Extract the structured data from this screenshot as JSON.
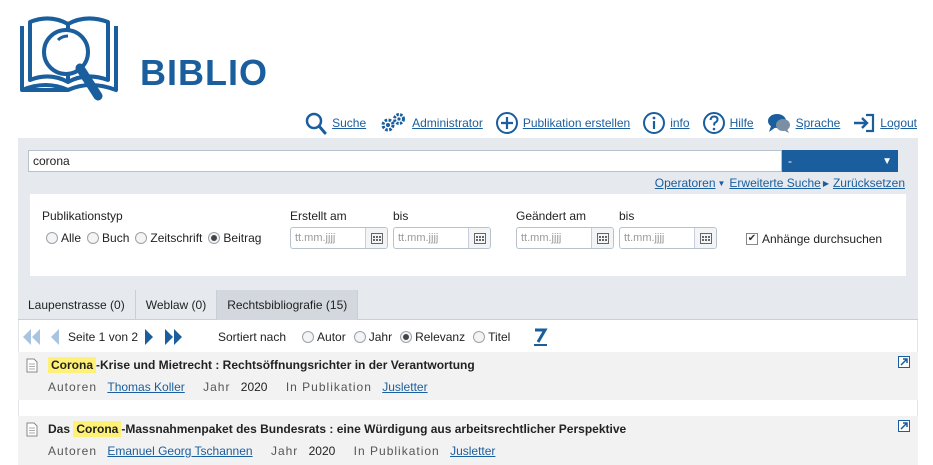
{
  "brand": {
    "name": "BIBLIO"
  },
  "topnav": [
    {
      "icon": "search-icon",
      "label": "Suche"
    },
    {
      "icon": "gears-icon",
      "label": "Administrator"
    },
    {
      "icon": "plus-circle-icon",
      "label": "Publikation erstellen"
    },
    {
      "icon": "info-icon",
      "label": "info"
    },
    {
      "icon": "help-icon",
      "label": "Hilfe"
    },
    {
      "icon": "language-icon",
      "label": "Sprache"
    },
    {
      "icon": "logout-icon",
      "label": "Logout"
    }
  ],
  "search": {
    "value": "corona",
    "scope_value": "-"
  },
  "links": {
    "operators": "Operatoren",
    "advanced": "Erweiterte Suche",
    "reset": "Zurücksetzen"
  },
  "filters": {
    "pubtype_label": "Publikationstyp",
    "pubtype_options": [
      "Alle",
      "Buch",
      "Zeitschrift",
      "Beitrag"
    ],
    "pubtype_selected": "Beitrag",
    "created_label": "Erstellt am",
    "changed_label": "Geändert am",
    "bis_label": "bis",
    "date_placeholder": "tt.mm.jjjj",
    "attachments_label": "Anhänge durchsuchen",
    "attachments_checked": true
  },
  "tabs": [
    {
      "label": "Laupenstrasse (0)",
      "active": false
    },
    {
      "label": "Weblaw (0)",
      "active": false
    },
    {
      "label": "Rechtsbibliografie (15)",
      "active": true
    }
  ],
  "pager": {
    "page_text": "Seite 1 von 2"
  },
  "sort": {
    "label": "Sortiert nach",
    "options": [
      "Autor",
      "Jahr",
      "Relevanz",
      "Titel"
    ],
    "selected": "Relevanz"
  },
  "results": [
    {
      "highlight": "Corona",
      "title_before": "",
      "title_after": "-Krise und Mietrecht : Rechtsöffnungsrichter in der Verantwortung",
      "authors_label": "Autoren",
      "author": "Thomas Koller",
      "year_label": "Jahr",
      "year": "2020",
      "pub_label": "In Publikation",
      "publication": "Jusletter"
    },
    {
      "highlight": "Corona",
      "title_before": "Das",
      "title_after": "-Massnahmenpaket des Bundesrats : eine Würdigung aus arbeitsrechtlicher Perspektive",
      "authors_label": "Autoren",
      "author": "Emanuel Georg Tschannen",
      "year_label": "Jahr",
      "year": "2020",
      "pub_label": "In Publikation",
      "publication": "Jusletter"
    }
  ],
  "colors": {
    "brand": "#1a5e9e",
    "panel": "#e6eaee",
    "highlight": "#fff176"
  }
}
